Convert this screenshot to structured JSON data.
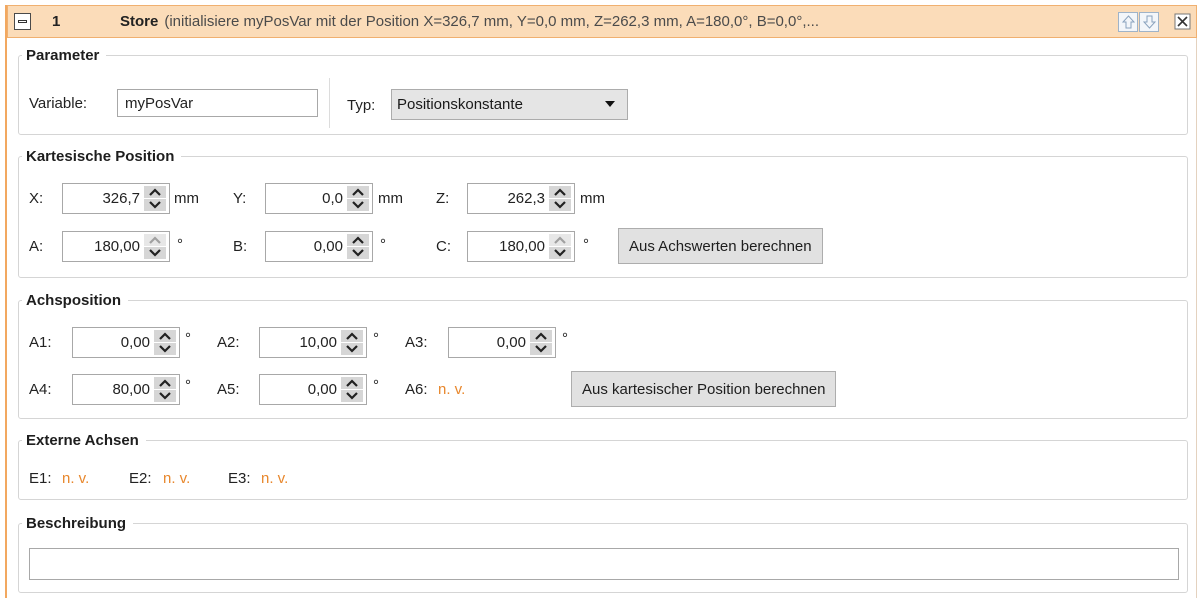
{
  "header": {
    "index": "1",
    "command": "Store",
    "detail": "(initialisiere myPosVar mit der Position X=326,7 mm, Y=0,0 mm, Z=262,3 mm, A=180,0°, B=0,0°,..."
  },
  "parameter": {
    "legend": "Parameter",
    "variable_label": "Variable:",
    "variable_value": "myPosVar",
    "typ_label": "Typ:",
    "typ_value": "Positionskonstante"
  },
  "cartesian": {
    "legend": "Kartesische Position",
    "x_label": "X:",
    "x_value": "326,7",
    "y_label": "Y:",
    "y_value": "0,0",
    "z_label": "Z:",
    "z_value": "262,3",
    "unit_mm": "mm",
    "a_label": "A:",
    "a_value": "180,00",
    "b_label": "B:",
    "b_value": "0,00",
    "c_label": "C:",
    "c_value": "180,00",
    "unit_deg": "°",
    "calc_button": "Aus Achswerten berechnen"
  },
  "axes": {
    "legend": "Achsposition",
    "a1_label": "A1:",
    "a1_value": "0,00",
    "a2_label": "A2:",
    "a2_value": "10,00",
    "a3_label": "A3:",
    "a3_value": "0,00",
    "a4_label": "A4:",
    "a4_value": "80,00",
    "a5_label": "A5:",
    "a5_value": "0,00",
    "a6_label": "A6:",
    "a6_value": "n. v.",
    "unit_deg": "°",
    "calc_button": "Aus kartesischer Position berechnen"
  },
  "external": {
    "legend": "Externe Achsen",
    "e1_label": "E1:",
    "e1_value": "n. v.",
    "e2_label": "E2:",
    "e2_value": "n. v.",
    "e3_label": "E3:",
    "e3_value": "n. v."
  },
  "description": {
    "legend": "Beschreibung",
    "value": ""
  },
  "colors": {
    "header_bg": "#fbdcb9",
    "header_border": "#f0b070",
    "not_available": "#e8872c"
  }
}
